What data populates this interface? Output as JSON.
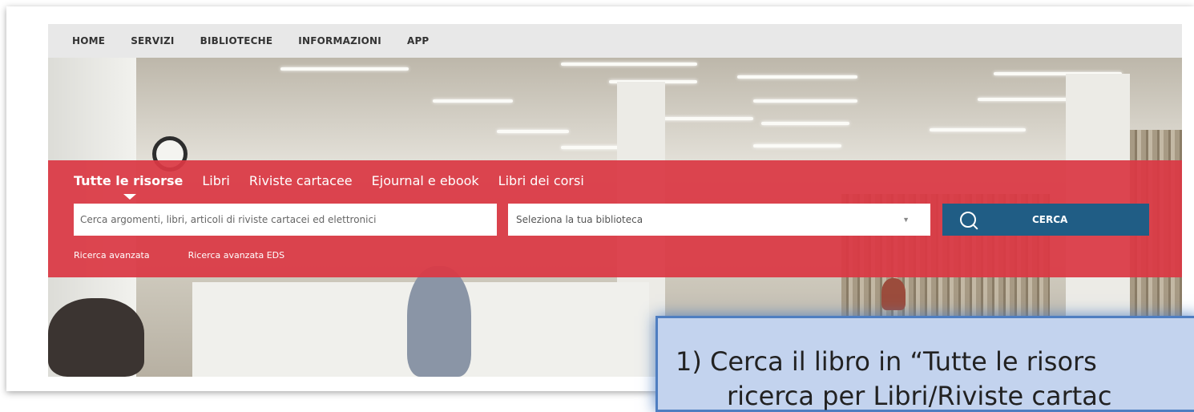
{
  "nav": {
    "items": [
      {
        "label": "HOME"
      },
      {
        "label": "SERVIZI"
      },
      {
        "label": "BIBLIOTECHE"
      },
      {
        "label": "INFORMAZIONI"
      },
      {
        "label": "APP"
      }
    ]
  },
  "search": {
    "tabs": [
      {
        "label": "Tutte le risorse",
        "active": true
      },
      {
        "label": "Libri"
      },
      {
        "label": "Riviste cartacee"
      },
      {
        "label": "Ejournal e ebook"
      },
      {
        "label": "Libri dei corsi"
      }
    ],
    "placeholder": "Cerca argomenti, libri, articoli di riviste cartacei ed elettronici",
    "library_select": "Seleziona la tua biblioteca",
    "button_label": "CERCA",
    "advanced_links": [
      {
        "label": "Ricerca avanzata"
      },
      {
        "label": "Ricerca avanzata EDS"
      }
    ]
  },
  "callout": {
    "line1": "1)  Cerca il libro in “Tutte le risors",
    "line2": "ricerca per Libri/Riviste cartac"
  },
  "colors": {
    "band": "#da3844",
    "button": "#205d85",
    "nav_bg": "#e8e8e8",
    "callout_bg": "#c3d3ee",
    "callout_border": "#4f7ec1"
  },
  "icons": {
    "search_button": "search-icon",
    "select": "chevron-down-icon"
  }
}
